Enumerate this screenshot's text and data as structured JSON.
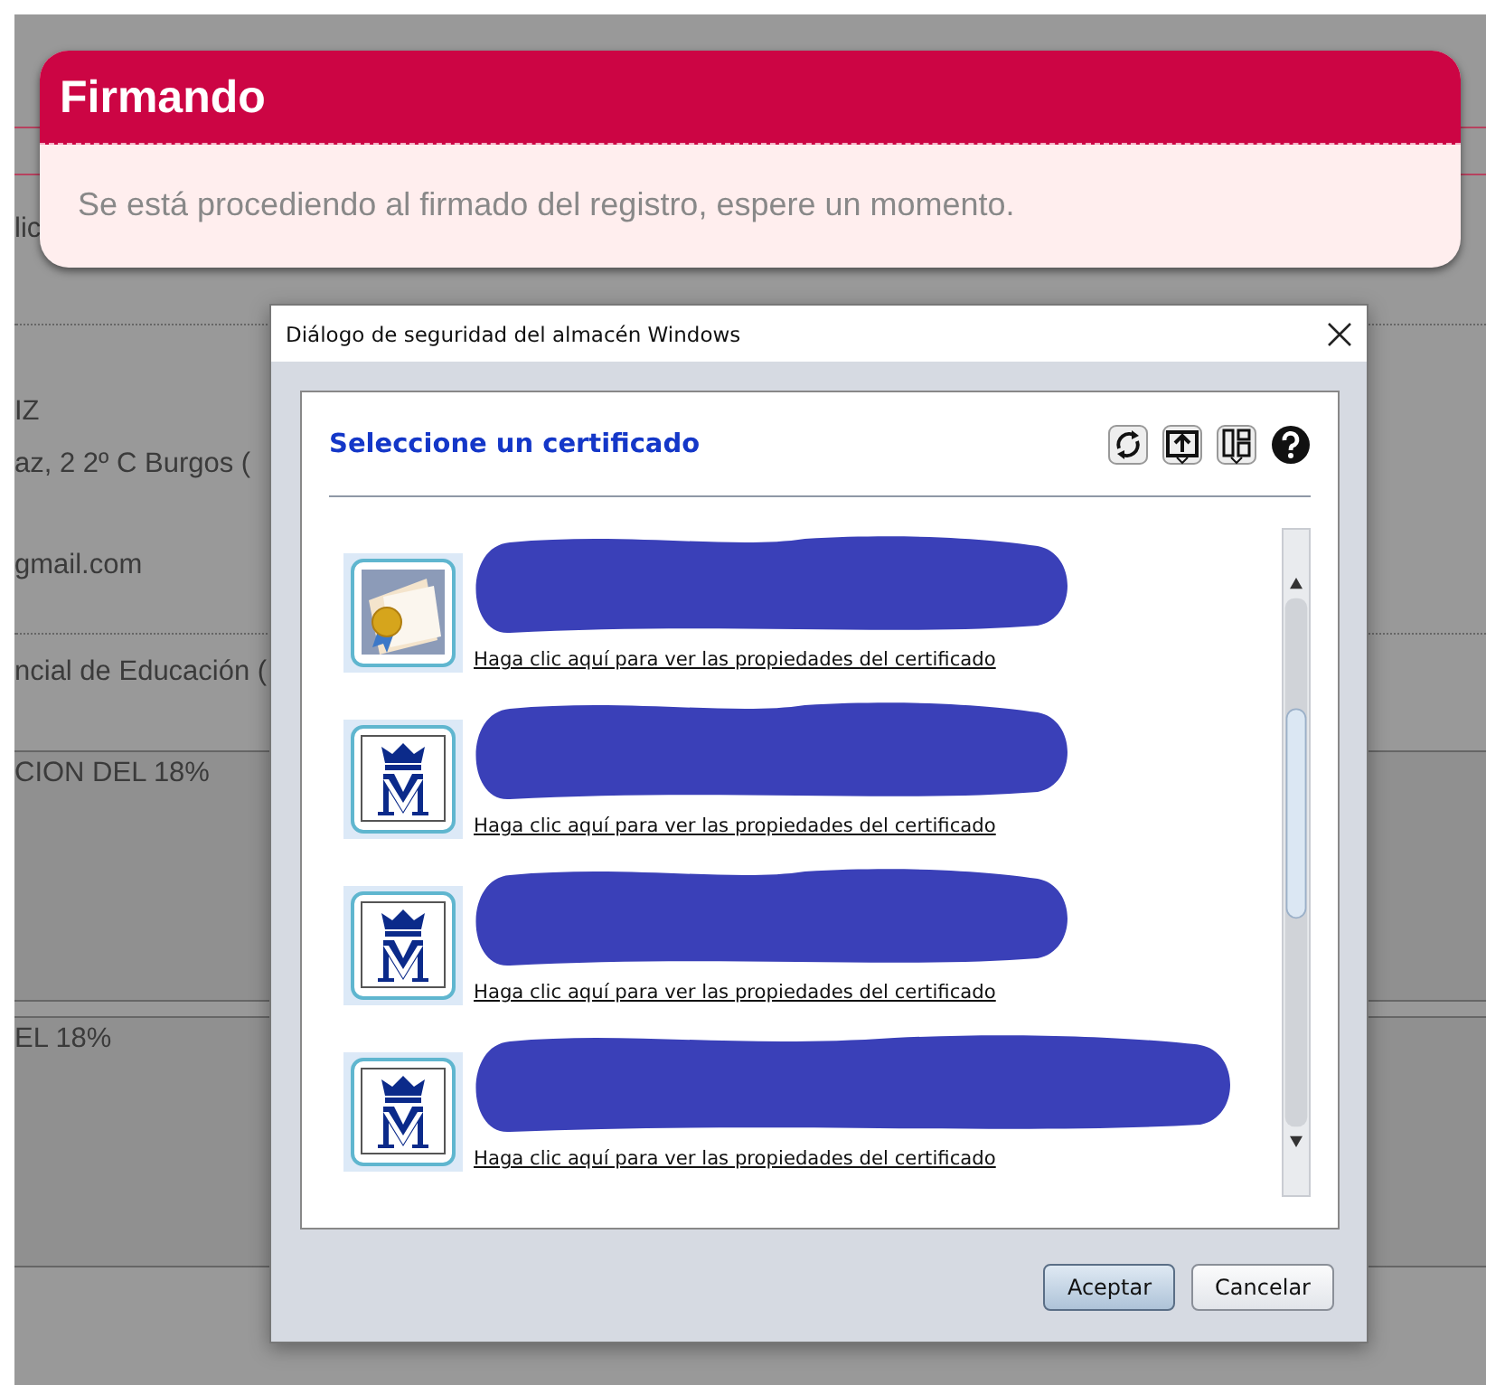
{
  "background_page": {
    "texts": [
      "lic",
      "IZ",
      "az, 2 2º C Burgos (",
      "gmail.com",
      "ncial de Educación (",
      "CION DEL 18%",
      "EL 18%"
    ]
  },
  "notice": {
    "title": "Firmando",
    "message": "Se está procediendo al firmado del registro, espere un momento."
  },
  "dialog": {
    "title": "Diálogo de seguridad del almacén Windows",
    "heading": "Seleccione un certificado",
    "certificates": [
      {
        "kind": "generic",
        "redacted": true,
        "link": "Haga clic aquí para ver las propiedades del certificado"
      },
      {
        "kind": "fnmt",
        "redacted": true,
        "link": "Haga clic aquí para ver las propiedades del certificado"
      },
      {
        "kind": "fnmt",
        "redacted": true,
        "link": "Haga clic aquí para ver las propiedades del certificado"
      },
      {
        "kind": "fnmt",
        "redacted": true,
        "link": "Haga clic aquí para ver las propiedades del certificado"
      }
    ],
    "buttons": [
      {
        "label": "Aceptar",
        "default": true
      },
      {
        "label": "Cancelar",
        "default": false
      }
    ]
  }
}
